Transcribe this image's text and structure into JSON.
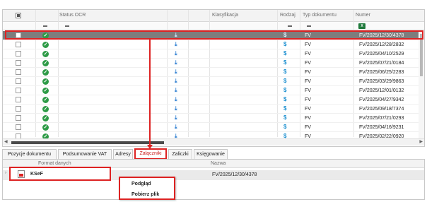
{
  "grid": {
    "headers": {
      "status_ocr": "Status OCR",
      "klasyfikacja": "Klasyfikacja",
      "rodzaj": "Rodzaj",
      "typ_dokumentu": "Typ dokumentu",
      "numer": "Numer"
    },
    "rows": [
      {
        "typ": "FV",
        "numer": "FV/2025/12/30/4378",
        "selected": true
      },
      {
        "typ": "FV",
        "numer": "FV/2025/12/28/2832",
        "selected": false
      },
      {
        "typ": "FV",
        "numer": "FV/2025/04/10/2529",
        "selected": false
      },
      {
        "typ": "FV",
        "numer": "FV/2025/07/21/0184",
        "selected": false
      },
      {
        "typ": "FV",
        "numer": "FV/2025/06/25/2283",
        "selected": false
      },
      {
        "typ": "FV",
        "numer": "FV/2025/03/29/9863",
        "selected": false
      },
      {
        "typ": "FV",
        "numer": "FV/2025/12/01/0132",
        "selected": false
      },
      {
        "typ": "FV",
        "numer": "FV/2025/04/27/9342",
        "selected": false
      },
      {
        "typ": "FV",
        "numer": "FV/2025/09/18/7374",
        "selected": false
      },
      {
        "typ": "FV",
        "numer": "FV/2025/07/21/0293",
        "selected": false
      },
      {
        "typ": "FV",
        "numer": "FV/2025/04/16/9231",
        "selected": false
      },
      {
        "typ": "FV",
        "numer": "FV/2025/02/22/0920",
        "selected": false
      }
    ],
    "icons": {
      "status": "check-circle-icon",
      "download": "download-icon",
      "rodzaj": "dollar-icon",
      "excel": "excel-icon"
    },
    "excel_label": "X"
  },
  "tabs": [
    {
      "label": "Pozycje dokumentu",
      "active": false
    },
    {
      "label": "Podsumowanie VAT",
      "active": false
    },
    {
      "label": "Adresy",
      "active": false
    },
    {
      "label": "Załączniki",
      "active": true
    },
    {
      "label": "Zaliczki",
      "active": false
    },
    {
      "label": "Księgowanie",
      "active": false
    }
  ],
  "attachments": {
    "headers": {
      "format": "Format danych",
      "nazwa": "Nazwa"
    },
    "row": {
      "format": "KSeF",
      "nazwa": "FV/2025/12/30/4378"
    }
  },
  "context_menu": {
    "items": [
      "Podgląd",
      "Pobierz plik"
    ]
  },
  "colors": {
    "highlight": "#dd2222",
    "selected_row": "#7d7d7d",
    "status_ok": "#2e9b47",
    "download": "#2f7fd1"
  }
}
